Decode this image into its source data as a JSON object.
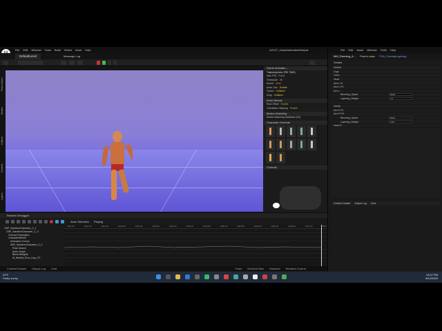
{
  "main_window": {
    "logo": "U",
    "menu": [
      "File",
      "Edit",
      "Window",
      "Tools",
      "Build",
      "Select",
      "Actor",
      "Help"
    ],
    "project_tab": "DefaultLevel",
    "toolbar_items": [
      "Selection Mode",
      "Message Log"
    ],
    "window_title": "A21XT_GameAnimationSample",
    "viewport_label": "Viewport 1",
    "side_tabs": [
      "Place Actors",
      "Modes",
      "Outliner",
      "Content",
      "Layers"
    ],
    "status_items": [
      "Content Drawer",
      "Output Log",
      "Cmd",
      "Trace",
      "Derived Data",
      "Unsaved",
      "Revision Control"
    ]
  },
  "right_panel": {
    "header": "Game Animatio...",
    "rows": [
      {
        "label": "TrajectoryActor (PIE TIME)",
        "value": ""
      },
      {
        "label": "Max FPS",
        "value": "Fixed",
        "cls": "hl-green"
      },
      {
        "label": "Timescale",
        "value": "20"
      },
      {
        "label": "Sound",
        "value": "Mute",
        "cls": "hl-red"
      },
      {
        "label": "Anim Calc",
        "value": "Enable"
      },
      {
        "label": "Traces",
        "value": "Collision",
        "cls": "hl-yel"
      },
      {
        "label": "Drag",
        "value": "Collision",
        "cls": "hl-yel"
      }
    ],
    "anim_section": "Anim Blends",
    "anim_rows": [
      {
        "label": "Root Offset",
        "value": "Enable",
        "cls": "hl-green"
      },
      {
        "label": "Orientation Warping",
        "value": "Enable",
        "cls": "hl-green"
      }
    ],
    "mm_section": "Motion Matching",
    "mm_row": "Motion Matching Database (20)",
    "char_section": "Character Override",
    "controls_label": "Controls"
  },
  "rewind": {
    "title": "Rewind Debugger",
    "dropdowns": [
      "Actor Selection",
      "Playing"
    ],
    "tree": [
      {
        "label": "CBP_SandboxCharacter_C_1",
        "indent": 0
      },
      {
        "label": "CBP_SandboxCharacter_C_0",
        "indent": 1
      },
      {
        "label": "Chooser Evaluation",
        "indent": 2
      },
      {
        "label": "CharacterMesh0",
        "indent": 2
      },
      {
        "label": "Animation Curves",
        "indent": 3
      },
      {
        "label": "ABP_SandboxCharacter_C_0",
        "indent": 3
      },
      {
        "label": "Pose Search",
        "indent": 4
      },
      {
        "label": "Anim Graph",
        "indent": 4
      },
      {
        "label": "Blend Weights",
        "indent": 4
      },
      {
        "label": "M_Neutral_Run_Loop_F0",
        "indent": 4
      }
    ],
    "ruler": [
      "1001.60",
      "1002.00",
      "1002.40",
      "1002.80",
      "1003.20",
      "1003.60",
      "1004.00",
      "1004.40",
      "1004.80",
      "1005.20",
      "1005.60",
      "1006.00",
      "1006.40",
      "1006.80",
      "1007.20",
      "1007.60"
    ]
  },
  "bottom_left": {
    "line1": "29°F",
    "line2": "Partly sunny"
  },
  "clock": {
    "time": "12:07 PM",
    "date": "6/12/2024"
  },
  "second_window": {
    "menu": [
      "File",
      "Edit",
      "Asset",
      "Window",
      "Tools",
      "Help"
    ],
    "asset_tab": "MM_Running_A...",
    "parent_class_label": "Parent class",
    "parent_class": "PSA_OverlayLayering",
    "details_tab": "Details",
    "details_rows": [
      {
        "label": "Default",
        "value": ""
      },
      {
        "label": "Legs",
        "value": ""
      },
      {
        "label": "Torso",
        "value": ""
      },
      {
        "label": "Head",
        "value": ""
      },
      {
        "label": "Arm L IK",
        "value": ""
      },
      {
        "label": "Arm L FK",
        "value": ""
      },
      {
        "label": "Arm L",
        "value": ""
      },
      {
        "label": "Blending_Space",
        "value": "Mesh"
      },
      {
        "label": "Layering_Weight",
        "value": "1.0"
      },
      {
        "label": "",
        "value": ""
      },
      {
        "label": "Hands",
        "value": ""
      },
      {
        "label": "Arm R IK",
        "value": ""
      },
      {
        "label": "Arm R FK",
        "value": ""
      },
      {
        "label": "Blending_Space",
        "value": "Mesh"
      },
      {
        "label": "Layering_Weight",
        "value": "0.25"
      },
      {
        "label": "Hand R",
        "value": ""
      }
    ],
    "bottom_items": [
      "Content Drawer",
      "Output Log",
      "Cmd"
    ]
  }
}
